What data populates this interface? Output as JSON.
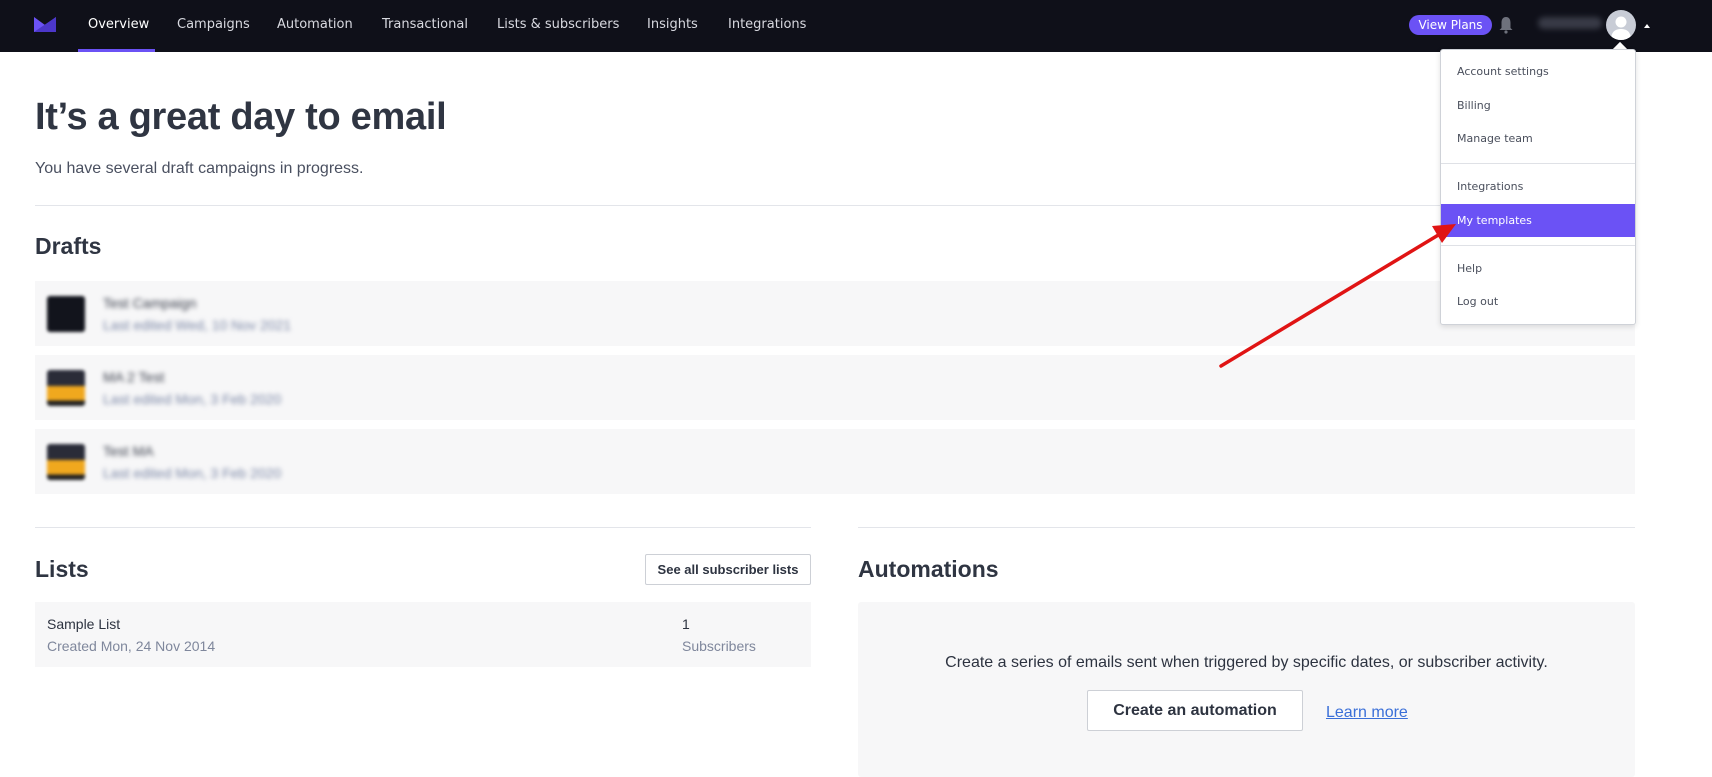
{
  "nav": {
    "items": [
      {
        "label": "Overview",
        "active": true
      },
      {
        "label": "Campaigns"
      },
      {
        "label": "Automation"
      },
      {
        "label": "Transactional"
      },
      {
        "label": "Lists & subscribers"
      },
      {
        "label": "Insights"
      },
      {
        "label": "Integrations"
      }
    ],
    "view_plans_label": "View Plans",
    "account_name": "Tid Studio",
    "accent_color": "#6b52f5",
    "bg_color": "#0f1019"
  },
  "account_menu": {
    "items": [
      {
        "label": "Account settings"
      },
      {
        "label": "Billing"
      },
      {
        "label": "Manage team"
      },
      {
        "label": "Integrations"
      },
      {
        "label": "My templates",
        "highlighted": true
      },
      {
        "label": "Help"
      },
      {
        "label": "Log out"
      }
    ]
  },
  "main": {
    "title": "It’s a great day to email",
    "subtitle": "You have several draft campaigns in progress.",
    "drafts": {
      "heading": "Drafts",
      "items": [
        {
          "name": "Test Campaign",
          "date": "Last edited Wed, 10 Nov 2021",
          "thumb": "dark"
        },
        {
          "name": "MA 2 Test",
          "date": "Last edited Mon, 3 Feb 2020",
          "thumb": "orange"
        },
        {
          "name": "Test MA",
          "date": "Last edited Mon, 3 Feb 2020",
          "thumb": "orange"
        }
      ]
    },
    "lists": {
      "heading": "Lists",
      "see_all_label": "See all subscriber lists",
      "items": [
        {
          "name": "Sample List",
          "created": "Created Mon, 24 Nov 2014",
          "count": "1",
          "count_label": "Subscribers"
        }
      ]
    },
    "automations": {
      "heading": "Automations",
      "description": "Create a series of emails sent when triggered by specific dates, or subscriber activity.",
      "create_label": "Create an automation",
      "learn_more_label": "Learn more"
    }
  },
  "annotation": {
    "type": "arrow",
    "color": "#e01414",
    "points_to": "My templates"
  }
}
